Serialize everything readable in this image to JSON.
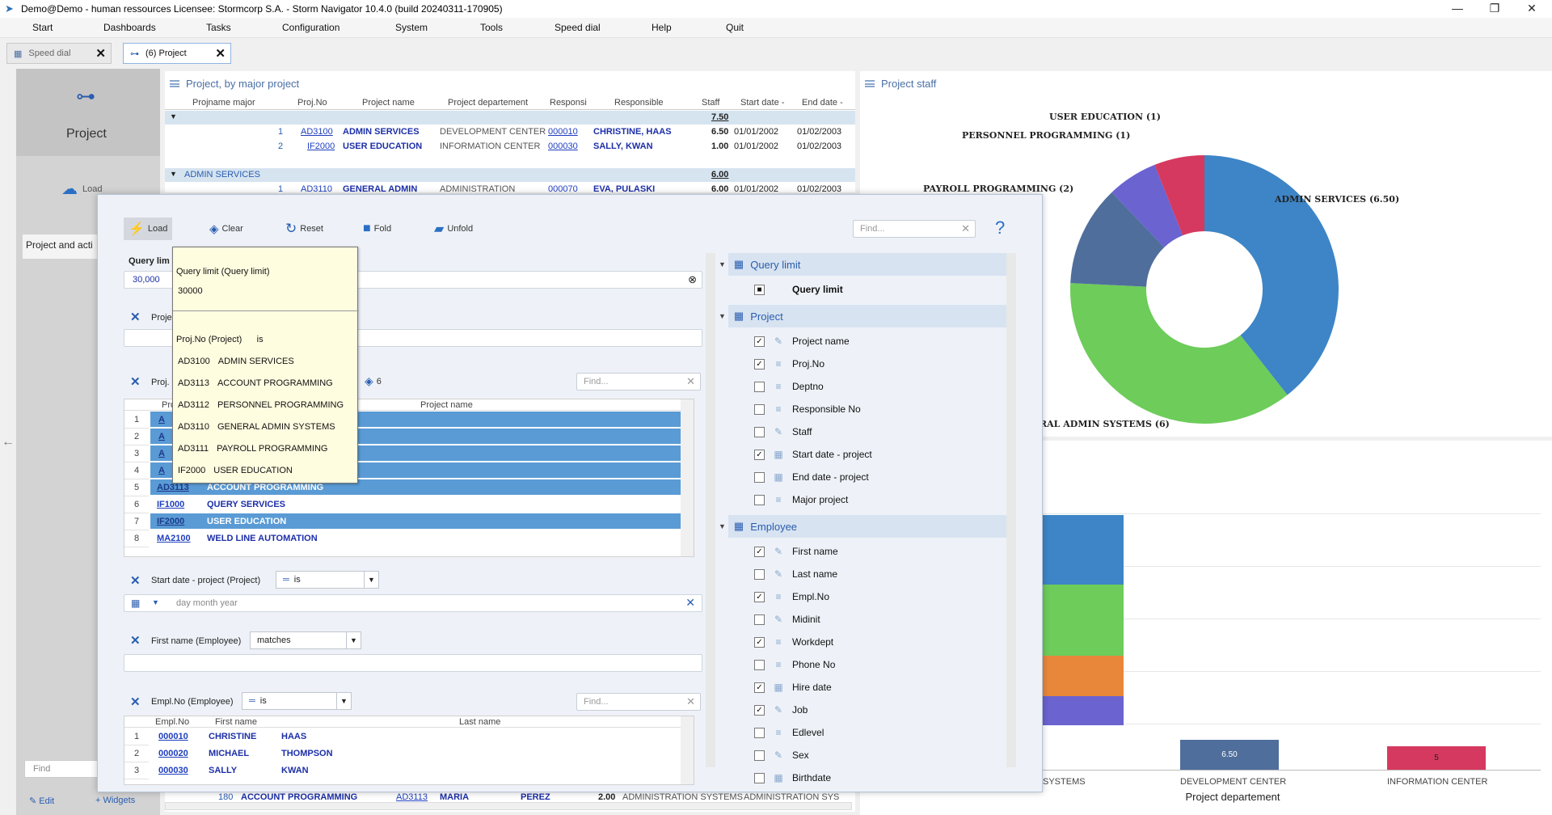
{
  "titlebar": {
    "title": "Demo@Demo - human ressources    Licensee: Stormcorp S.A. -  Storm Navigator 10.4.0 (build 20240311-170905)"
  },
  "menu": [
    "Start",
    "Dashboards",
    "Tasks",
    "Configuration",
    "System",
    "Tools",
    "Speed dial",
    "Help",
    "Quit"
  ],
  "tabs": [
    {
      "label": "Speed dial"
    },
    {
      "label": "(6) Project"
    }
  ],
  "sidebar": {
    "title": "Project",
    "load": "Load",
    "item": "Project and acti",
    "find_placeholder": "Find",
    "edit": "Edit",
    "widgets": "Widgets"
  },
  "project_table": {
    "title": "Project, by major project",
    "columns": [
      "Projname major",
      "Proj.No",
      "Project name",
      "Project departement",
      "Responsi",
      "Responsible",
      "Staff",
      "Start date -",
      "End date -"
    ],
    "group1_total": "7.50",
    "rows": [
      {
        "n": "1",
        "no": "AD3100",
        "name": "ADMIN SERVICES",
        "dept": "DEVELOPMENT CENTER",
        "resp": "000010",
        "respname": "CHRISTINE, HAAS",
        "staff": "6.50",
        "start": "01/01/2002",
        "end": "01/02/2003"
      },
      {
        "n": "2",
        "no": "IF2000",
        "name": "USER EDUCATION",
        "dept": "INFORMATION CENTER",
        "resp": "000030",
        "respname": "SALLY, KWAN",
        "staff": "1.00",
        "start": "01/01/2002",
        "end": "01/02/2003"
      }
    ],
    "group2": "ADMIN SERVICES",
    "group2_total": "6.00",
    "row3": {
      "n": "1",
      "no": "AD3110",
      "name": "GENERAL ADMIN",
      "dept": "ADMINISTRATION",
      "resp": "000070",
      "respname": "EVA, PULASKI",
      "staff": "6.00",
      "start": "01/01/2002",
      "end": "01/02/2003"
    },
    "bottom_row": {
      "n": "180",
      "name": "ACCOUNT PROGRAMMING",
      "no": "AD3113",
      "first": "MARIA",
      "last": "PEREZ",
      "staff": "2.00",
      "d1": "ADMINISTRATION SYSTEMS",
      "d2": "ADMINISTRATION SYS"
    }
  },
  "staff_chart": {
    "title": "Project staff",
    "chart_data": {
      "type": "pie",
      "labels": [
        "ADMIN SERVICES",
        "GENERAL ADMIN SYSTEMS",
        "PAYROLL PROGRAMMING",
        "PERSONNEL PROGRAMMING",
        "USER EDUCATION"
      ],
      "values": [
        6.5,
        6,
        2,
        1,
        1
      ],
      "colors": [
        "#3d85c6",
        "#6dcc5a",
        "#e8873a",
        "#4f6e9c",
        "#6a63d0",
        "#d6395f"
      ],
      "visible_labels": [
        "ADMIN SERVICES (6.50)",
        "RAL ADMIN SYSTEMS (6)",
        "PAYROLL PROGRAMMING (2)",
        "PERSONNEL PROGRAMMING (1)",
        "USER EDUCATION (1)"
      ]
    }
  },
  "bar_chart": {
    "chart_data": {
      "type": "bar",
      "categories": [
        "SYSTEMS",
        "DEVELOPMENT CENTER",
        "INFORMATION CENTER"
      ],
      "xlabel": "Project departement",
      "data_labels": [
        "6.50",
        "5"
      ]
    }
  },
  "dialog": {
    "toolbar": {
      "load": "Load",
      "clear": "Clear",
      "reset": "Reset",
      "fold": "Fold",
      "unfold": "Unfold",
      "find": "Find...",
      "help": "?"
    },
    "query_limit": {
      "label": "Query lim",
      "value": "30,000"
    },
    "proj_filter_label": "Proje",
    "proj_list": {
      "label": "Proj.",
      "count": "6",
      "find": "Find...",
      "col_no": "Pro",
      "col_name": "Project name",
      "rows": [
        {
          "n": "1",
          "no": "A",
          "name": ""
        },
        {
          "n": "2",
          "no": "A",
          "name": ""
        },
        {
          "n": "3",
          "no": "A",
          "name": ""
        },
        {
          "n": "4",
          "no": "A",
          "name": ""
        },
        {
          "n": "5",
          "no": "AD3113",
          "name": "ACCOUNT PROGRAMMING"
        },
        {
          "n": "6",
          "no": "IF1000",
          "name": "QUERY SERVICES"
        },
        {
          "n": "7",
          "no": "IF2000",
          "name": "USER EDUCATION"
        },
        {
          "n": "8",
          "no": "MA2100",
          "name": "WELD LINE AUTOMATION"
        }
      ]
    },
    "start_date": {
      "label": "Start date - project (Project)",
      "op": "is",
      "placeholder": "day month year"
    },
    "first_name": {
      "label": "First name (Employee)",
      "op": "matches"
    },
    "empl": {
      "label": "Empl.No (Employee)",
      "op": "is",
      "find": "Find...",
      "cols": [
        "Empl.No",
        "First name",
        "Last name"
      ],
      "rows": [
        {
          "n": "1",
          "no": "000010",
          "first": "CHRISTINE",
          "last": "HAAS"
        },
        {
          "n": "2",
          "no": "000020",
          "first": "MICHAEL",
          "last": "THOMPSON"
        },
        {
          "n": "3",
          "no": "000030",
          "first": "SALLY",
          "last": "KWAN"
        }
      ]
    },
    "tree": {
      "sections": [
        {
          "title": "Query limit",
          "items": [
            {
              "label": "Query limit",
              "checked": "■"
            }
          ]
        },
        {
          "title": "Project",
          "items": [
            {
              "label": "Project name",
              "checked": "✓",
              "icon": "✎"
            },
            {
              "label": "Proj.No",
              "checked": "✓",
              "icon": "≡"
            },
            {
              "label": "Deptno",
              "checked": "",
              "icon": "≡"
            },
            {
              "label": "Responsible No",
              "checked": "",
              "icon": "≡"
            },
            {
              "label": "Staff",
              "checked": "",
              "icon": "✎"
            },
            {
              "label": "Start date - project",
              "checked": "✓",
              "icon": "▦"
            },
            {
              "label": "End date - project",
              "checked": "",
              "icon": "▦"
            },
            {
              "label": "Major project",
              "checked": "",
              "icon": "≡"
            }
          ]
        },
        {
          "title": "Employee",
          "items": [
            {
              "label": "First name",
              "checked": "✓",
              "icon": "✎"
            },
            {
              "label": "Last name",
              "checked": "",
              "icon": "✎"
            },
            {
              "label": "Empl.No",
              "checked": "✓",
              "icon": "≡"
            },
            {
              "label": "Midinit",
              "checked": "",
              "icon": "✎"
            },
            {
              "label": "Workdept",
              "checked": "✓",
              "icon": "≡"
            },
            {
              "label": "Phone No",
              "checked": "",
              "icon": "≡"
            },
            {
              "label": "Hire date",
              "checked": "✓",
              "icon": "▦"
            },
            {
              "label": "Job",
              "checked": "✓",
              "icon": "✎"
            },
            {
              "label": "Edlevel",
              "checked": "",
              "icon": "≡"
            },
            {
              "label": "Sex",
              "checked": "",
              "icon": "✎"
            },
            {
              "label": "Birthdate",
              "checked": "",
              "icon": "▦"
            }
          ]
        }
      ]
    }
  },
  "popup": {
    "title": "Query limit (Query limit)",
    "value": "30000",
    "filter": "Proj.No (Project)      is",
    "items": [
      {
        "code": "AD3100",
        "name": "ADMIN SERVICES"
      },
      {
        "code": "AD3113",
        "name": "ACCOUNT PROGRAMMING"
      },
      {
        "code": "AD3112",
        "name": "PERSONNEL PROGRAMMING"
      },
      {
        "code": "AD3110",
        "name": "GENERAL ADMIN SYSTEMS"
      },
      {
        "code": "AD3111",
        "name": "PAYROLL PROGRAMMING"
      },
      {
        "code": "IF2000",
        "name": "USER EDUCATION"
      }
    ]
  }
}
